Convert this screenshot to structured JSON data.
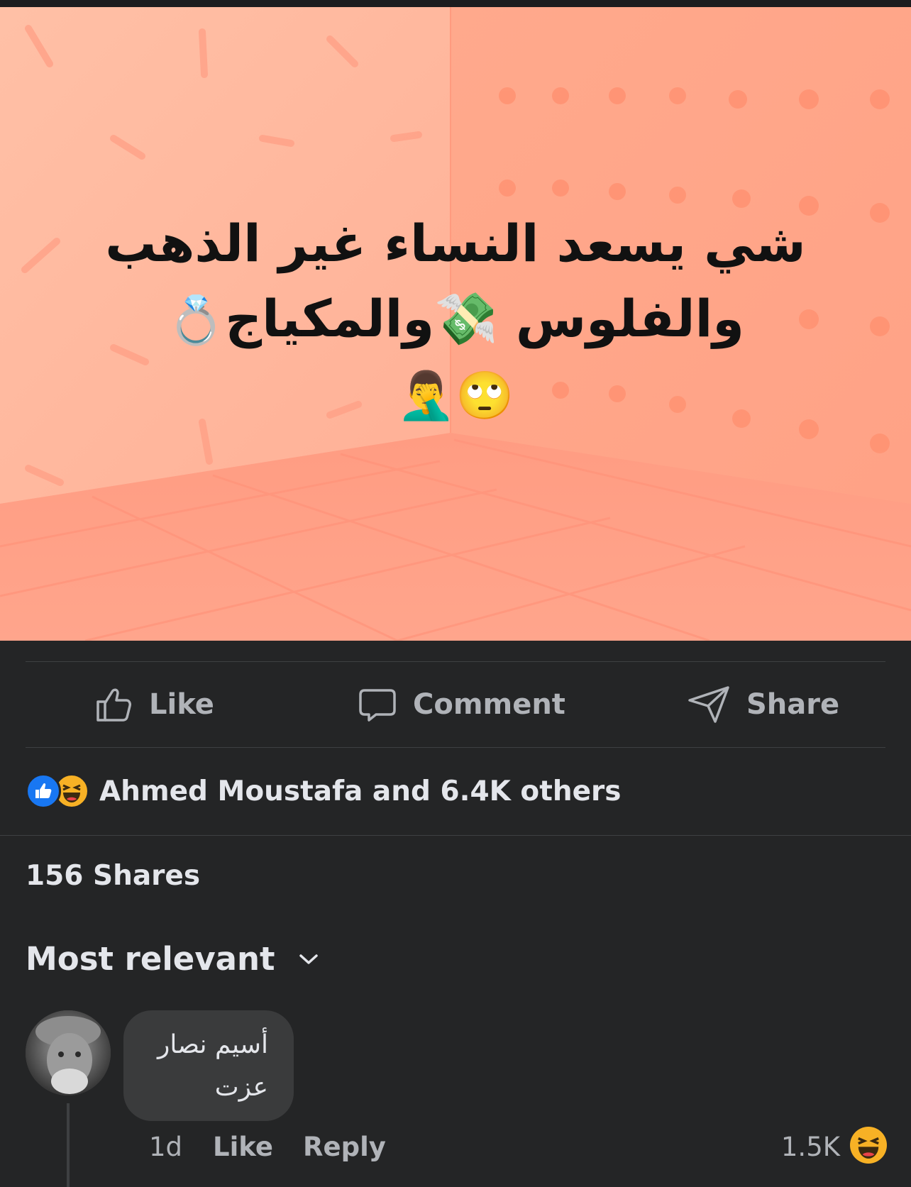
{
  "post": {
    "text_line1": "شي يسعد النساء غير الذهب",
    "text_line2": "والفلوس 💸والمكياج",
    "ring_emoji": "💍",
    "text_line3_emoji": "🙄🤦‍♂️"
  },
  "actions": {
    "like": "Like",
    "comment": "Comment",
    "share": "Share"
  },
  "reactions": {
    "summary": "Ahmed Moustafa and 6.4K others",
    "icons": [
      "like-icon",
      "haha-icon"
    ],
    "colors": {
      "like": "#1877f2",
      "haha": "#f7b125"
    }
  },
  "shares": "156 Shares",
  "sort": {
    "label": "Most relevant",
    "icon": "chevron-down-icon"
  },
  "comment": {
    "author": "أسيم نصار",
    "text": "عزت",
    "time": "1d",
    "like_label": "Like",
    "reply_label": "Reply",
    "reaction_count": "1.5K",
    "reaction_icon": "haha-icon"
  },
  "colors": {
    "background": "#242526",
    "image_bg": "#ffa88e",
    "muted_text": "#b0b3b8",
    "bubble": "#3a3b3c"
  }
}
